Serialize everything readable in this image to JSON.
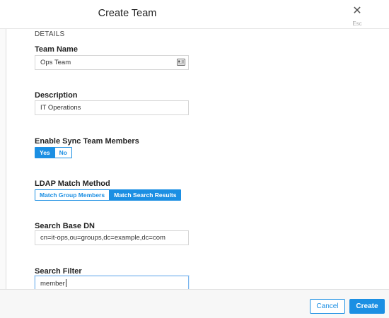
{
  "header": {
    "title": "Create Team",
    "close_icon": "close-icon",
    "close_hint": "Esc"
  },
  "form": {
    "section_title": "DETAILS",
    "team_name": {
      "label": "Team Name",
      "value": "Ops Team",
      "icon": "contact-card-icon"
    },
    "description": {
      "label": "Description",
      "value": "IT Operations"
    },
    "enable_sync": {
      "label": "Enable Sync Team Members",
      "options": [
        "Yes",
        "No"
      ],
      "selected": "Yes"
    },
    "ldap_match": {
      "label": "LDAP Match Method",
      "options": [
        "Match Group Members",
        "Match Search Results"
      ],
      "selected": "Match Search Results"
    },
    "search_base_dn": {
      "label": "Search Base DN",
      "value": "cn=it-ops,ou=groups,dc=example,dc=com"
    },
    "search_filter": {
      "label": "Search Filter",
      "value": "member"
    }
  },
  "footer": {
    "cancel_label": "Cancel",
    "create_label": "Create"
  },
  "colors": {
    "accent": "#1b8fe3",
    "border": "#d6d6d6",
    "focus_border": "#7cb6ee"
  }
}
